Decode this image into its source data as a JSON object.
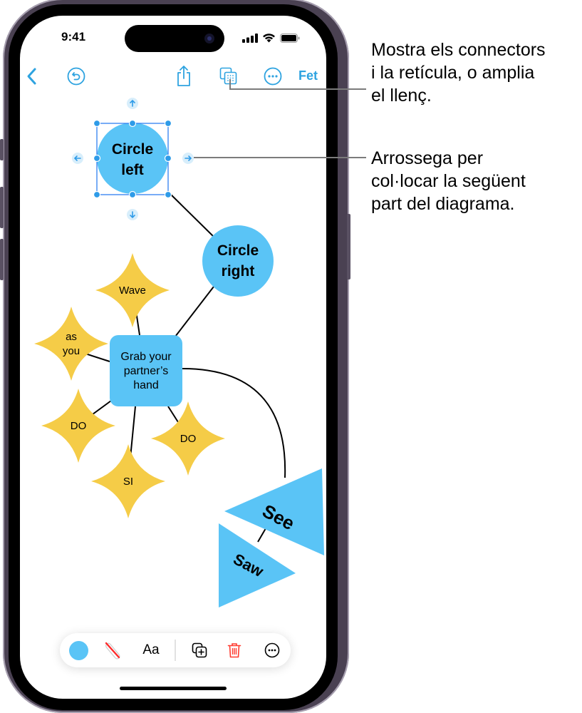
{
  "status_bar": {
    "time": "9:41",
    "icons": [
      "cellular-signal-icon",
      "wifi-icon",
      "battery-icon"
    ]
  },
  "nav_bar": {
    "back_icon": "chevron-left-icon",
    "undo_icon": "undo-circle-icon",
    "share_icon": "share-icon",
    "view_options_icon": "grid-overlap-icon",
    "more_icon": "ellipsis-circle-icon",
    "done_label": "Fet"
  },
  "diagram": {
    "colors": {
      "blue": "#5ac4f6",
      "yellow": "#f5cc47",
      "selection": "#2f7ff0",
      "connector": "#000000"
    },
    "nodes": [
      {
        "id": "circle-left",
        "shape": "circle",
        "lines": [
          "Circle",
          "left"
        ],
        "selected": true
      },
      {
        "id": "circle-right",
        "shape": "circle",
        "lines": [
          "Circle",
          "right"
        ]
      },
      {
        "id": "grab",
        "shape": "rounded-rect",
        "lines": [
          "Grab your",
          "partner’s",
          "hand"
        ]
      },
      {
        "id": "wave",
        "shape": "star",
        "lines": [
          "Wave"
        ]
      },
      {
        "id": "as-you",
        "shape": "star",
        "lines": [
          "as",
          "you"
        ]
      },
      {
        "id": "do-left",
        "shape": "star",
        "lines": [
          "DO"
        ]
      },
      {
        "id": "si",
        "shape": "star",
        "lines": [
          "SI"
        ]
      },
      {
        "id": "do-right",
        "shape": "star",
        "lines": [
          "DO"
        ]
      },
      {
        "id": "see",
        "shape": "triangle",
        "lines": [
          "See"
        ]
      },
      {
        "id": "saw",
        "shape": "triangle",
        "lines": [
          "Saw"
        ]
      }
    ],
    "connectors": [
      [
        "circle-left",
        "circle-right"
      ],
      [
        "circle-right",
        "grab"
      ],
      [
        "wave",
        "grab"
      ],
      [
        "as-you",
        "grab"
      ],
      [
        "do-left",
        "grab"
      ],
      [
        "si",
        "grab"
      ],
      [
        "do-right",
        "grab"
      ],
      [
        "grab",
        "see"
      ],
      [
        "see",
        "saw"
      ]
    ],
    "add_arrows": [
      "arrow-up-icon",
      "arrow-down-icon",
      "arrow-left-icon",
      "arrow-right-icon"
    ]
  },
  "format_bar": {
    "fill_color": "#5ac4f6",
    "items": [
      "fill-color-swatch",
      "no-stroke-icon",
      "text-style-button",
      "duplicate-icon",
      "trash-icon",
      "more-icon"
    ],
    "text_style_label": "Aa",
    "trash_color": "#ff3b30"
  },
  "callouts": [
    {
      "lines": [
        "Mostra els connectors",
        "i la retícula, o amplia",
        "el llenç."
      ]
    },
    {
      "lines": [
        "Arrossega per",
        "col·locar la següent",
        "part del diagrama."
      ]
    }
  ]
}
